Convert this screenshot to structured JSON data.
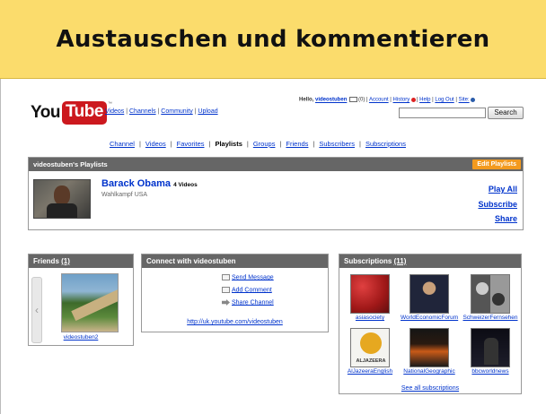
{
  "slide": {
    "title": "Austauschen und kommentieren"
  },
  "youtube": {
    "logo_you": "You",
    "logo_tube": "Tube",
    "logo_tm": "™",
    "top_nav": [
      "Videos",
      "Channels",
      "Community",
      "Upload"
    ],
    "greeting": "Hello,",
    "username": "videostuben",
    "inbox_count": "(0)",
    "account_links": [
      "Account",
      "History",
      "Help",
      "Log Out",
      "Site:"
    ],
    "search_value": "",
    "search_button": "Search"
  },
  "channel_nav": {
    "items": [
      "Channel",
      "Videos",
      "Favorites",
      "Playlists",
      "Groups",
      "Friends",
      "Subscribers",
      "Subscriptions"
    ],
    "active": "Playlists"
  },
  "playlists": {
    "header": "videostuben's Playlists",
    "edit_button": "Edit Playlists",
    "item": {
      "title": "Barack Obama",
      "count": "4 Videos",
      "subtitle": "Wahlkampf USA"
    },
    "actions": [
      "Play All",
      "Subscribe",
      "Share"
    ]
  },
  "friends": {
    "header_label": "Friends",
    "header_count": "(1)",
    "friend_name": "videostuben2"
  },
  "connect": {
    "header": "Connect with videostuben",
    "actions": [
      "Send Message",
      "Add Comment",
      "Share Channel"
    ],
    "url": "http://uk.youtube.com/videostuben"
  },
  "subscriptions": {
    "header_label": "Subscriptions",
    "header_count": "(11)",
    "items": [
      "asiasociety",
      "WorldEconomicForum",
      "SchweizerFernsehen",
      "AlJazeeraEnglish",
      "NationalGeographic",
      "bbcworldnews"
    ],
    "thumb_text_aljazeera": "ALJAZEERA",
    "see_all": "See all subscriptions"
  }
}
